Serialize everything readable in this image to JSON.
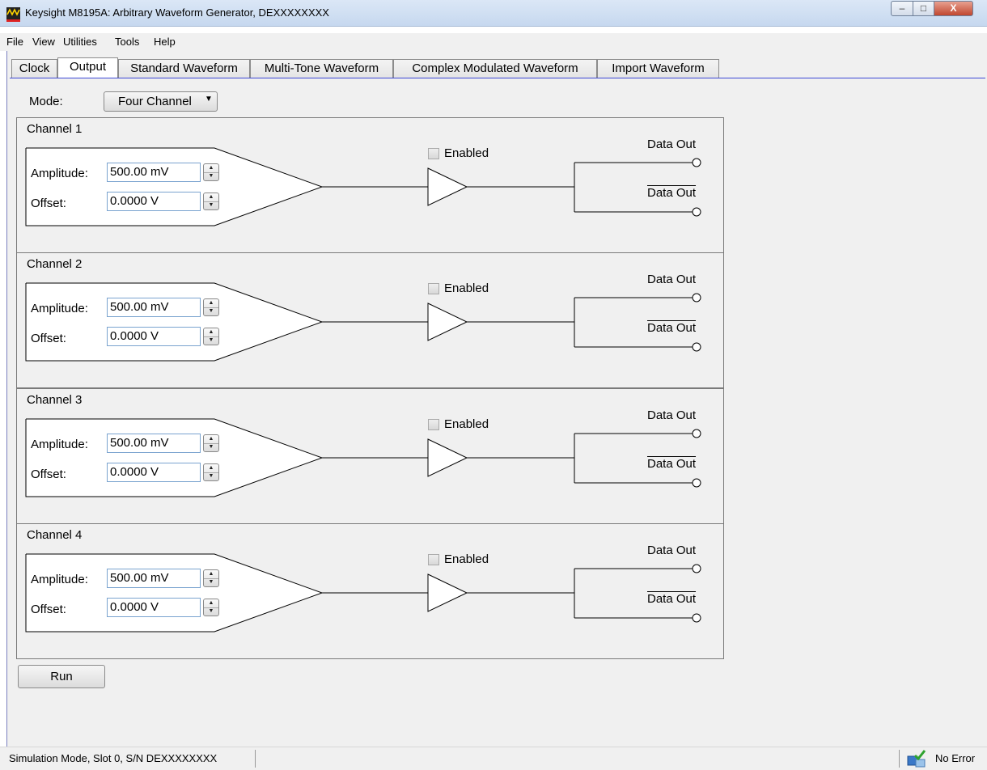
{
  "window": {
    "title": "Keysight M8195A: Arbitrary Waveform Generator, DEXXXXXXXX",
    "controls": {
      "minimize": "–",
      "maximize": "□",
      "close": "X"
    }
  },
  "menu": {
    "items": [
      "File",
      "View",
      "Utilities",
      "Tools",
      "Help"
    ]
  },
  "tabs": [
    {
      "label": "Clock",
      "active": false
    },
    {
      "label": "Output",
      "active": true
    },
    {
      "label": "Standard Waveform",
      "active": false
    },
    {
      "label": "Multi-Tone Waveform",
      "active": false
    },
    {
      "label": "Complex Modulated Waveform",
      "active": false
    },
    {
      "label": "Import Waveform",
      "active": false
    }
  ],
  "mode": {
    "label": "Mode:",
    "value": "Four Channel"
  },
  "channels": [
    {
      "title": "Channel 1",
      "amplitude_label": "Amplitude:",
      "amplitude": "500.00 mV",
      "offset_label": "Offset:",
      "offset": "0.0000 V",
      "enabled_label": "Enabled",
      "enabled": false,
      "data_out": "Data Out",
      "data_out_n": "Data Out"
    },
    {
      "title": "Channel 2",
      "amplitude_label": "Amplitude:",
      "amplitude": "500.00 mV",
      "offset_label": "Offset:",
      "offset": "0.0000 V",
      "enabled_label": "Enabled",
      "enabled": false,
      "data_out": "Data Out",
      "data_out_n": "Data Out"
    },
    {
      "title": "Channel 3",
      "amplitude_label": "Amplitude:",
      "amplitude": "500.00 mV",
      "offset_label": "Offset:",
      "offset": "0.0000 V",
      "enabled_label": "Enabled",
      "enabled": false,
      "data_out": "Data Out",
      "data_out_n": "Data Out"
    },
    {
      "title": "Channel 4",
      "amplitude_label": "Amplitude:",
      "amplitude": "500.00 mV",
      "offset_label": "Offset:",
      "offset": "0.0000 V",
      "enabled_label": "Enabled",
      "enabled": false,
      "data_out": "Data Out",
      "data_out_n": "Data Out"
    }
  ],
  "run_button": "Run",
  "status": {
    "left": "Simulation Mode, Slot 0, S/N DEXXXXXXXX",
    "right": "No Error"
  },
  "colors": {
    "tab_underline": "#3c48d6",
    "window_border": "#7b80c0",
    "field_border": "#7aa3cf",
    "panel_bg": "#f0f0f0"
  }
}
